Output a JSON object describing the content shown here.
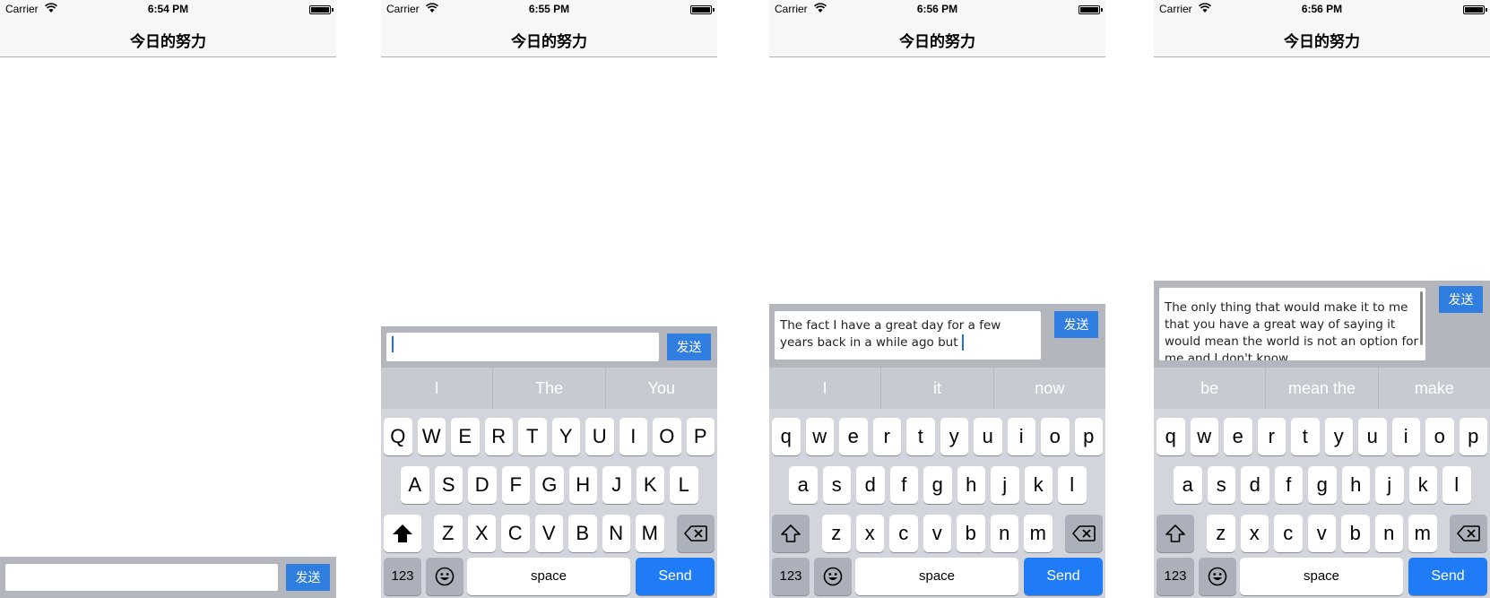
{
  "screens": [
    {
      "status": {
        "carrier": "Carrier",
        "time": "6:54 PM"
      },
      "title": "今日的努力",
      "input": {
        "text": "",
        "send": "发送"
      }
    },
    {
      "status": {
        "carrier": "Carrier",
        "time": "6:55 PM"
      },
      "title": "今日的努力",
      "input": {
        "text": "",
        "send": "发送"
      },
      "suggestions": [
        "I",
        "The",
        "You"
      ],
      "keyboard": {
        "row1": [
          "Q",
          "W",
          "E",
          "R",
          "T",
          "Y",
          "U",
          "I",
          "O",
          "P"
        ],
        "row2": [
          "A",
          "S",
          "D",
          "F",
          "G",
          "H",
          "J",
          "K",
          "L"
        ],
        "row3": [
          "Z",
          "X",
          "C",
          "V",
          "B",
          "N",
          "M"
        ],
        "numbers": "123",
        "space": "space",
        "send": "Send",
        "shift_active": true
      }
    },
    {
      "status": {
        "carrier": "Carrier",
        "time": "6:56 PM"
      },
      "title": "今日的努力",
      "input": {
        "text": "The fact I have a great day for a few years back in a while ago but ",
        "send": "发送"
      },
      "suggestions": [
        "I",
        "it",
        "now"
      ],
      "keyboard": {
        "row1": [
          "q",
          "w",
          "e",
          "r",
          "t",
          "y",
          "u",
          "i",
          "o",
          "p"
        ],
        "row2": [
          "a",
          "s",
          "d",
          "f",
          "g",
          "h",
          "j",
          "k",
          "l"
        ],
        "row3": [
          "z",
          "x",
          "c",
          "v",
          "b",
          "n",
          "m"
        ],
        "numbers": "123",
        "space": "space",
        "send": "Send",
        "shift_active": false
      }
    },
    {
      "status": {
        "carrier": "Carrier",
        "time": "6:56 PM"
      },
      "title": "今日的努力",
      "input": {
        "text": "The only thing that would make it to me that you have a great way of saying it would mean the world is not an option for me and I don't know",
        "send": "发送"
      },
      "suggestions": [
        "be",
        "mean the",
        "make"
      ],
      "keyboard": {
        "row1": [
          "q",
          "w",
          "e",
          "r",
          "t",
          "y",
          "u",
          "i",
          "o",
          "p"
        ],
        "row2": [
          "a",
          "s",
          "d",
          "f",
          "g",
          "h",
          "j",
          "k",
          "l"
        ],
        "row3": [
          "z",
          "x",
          "c",
          "v",
          "b",
          "n",
          "m"
        ],
        "numbers": "123",
        "space": "space",
        "send": "Send",
        "shift_active": false
      }
    }
  ],
  "icons": {
    "wifi": "wifi-icon",
    "battery": "battery-icon",
    "shift": "shift-icon",
    "delete": "backspace-icon",
    "emoji": "emoji-icon"
  },
  "colors": {
    "send_button": "#2f7ee0",
    "keyboard_send": "#1f7cf6",
    "caret": "#1f6fe8"
  }
}
